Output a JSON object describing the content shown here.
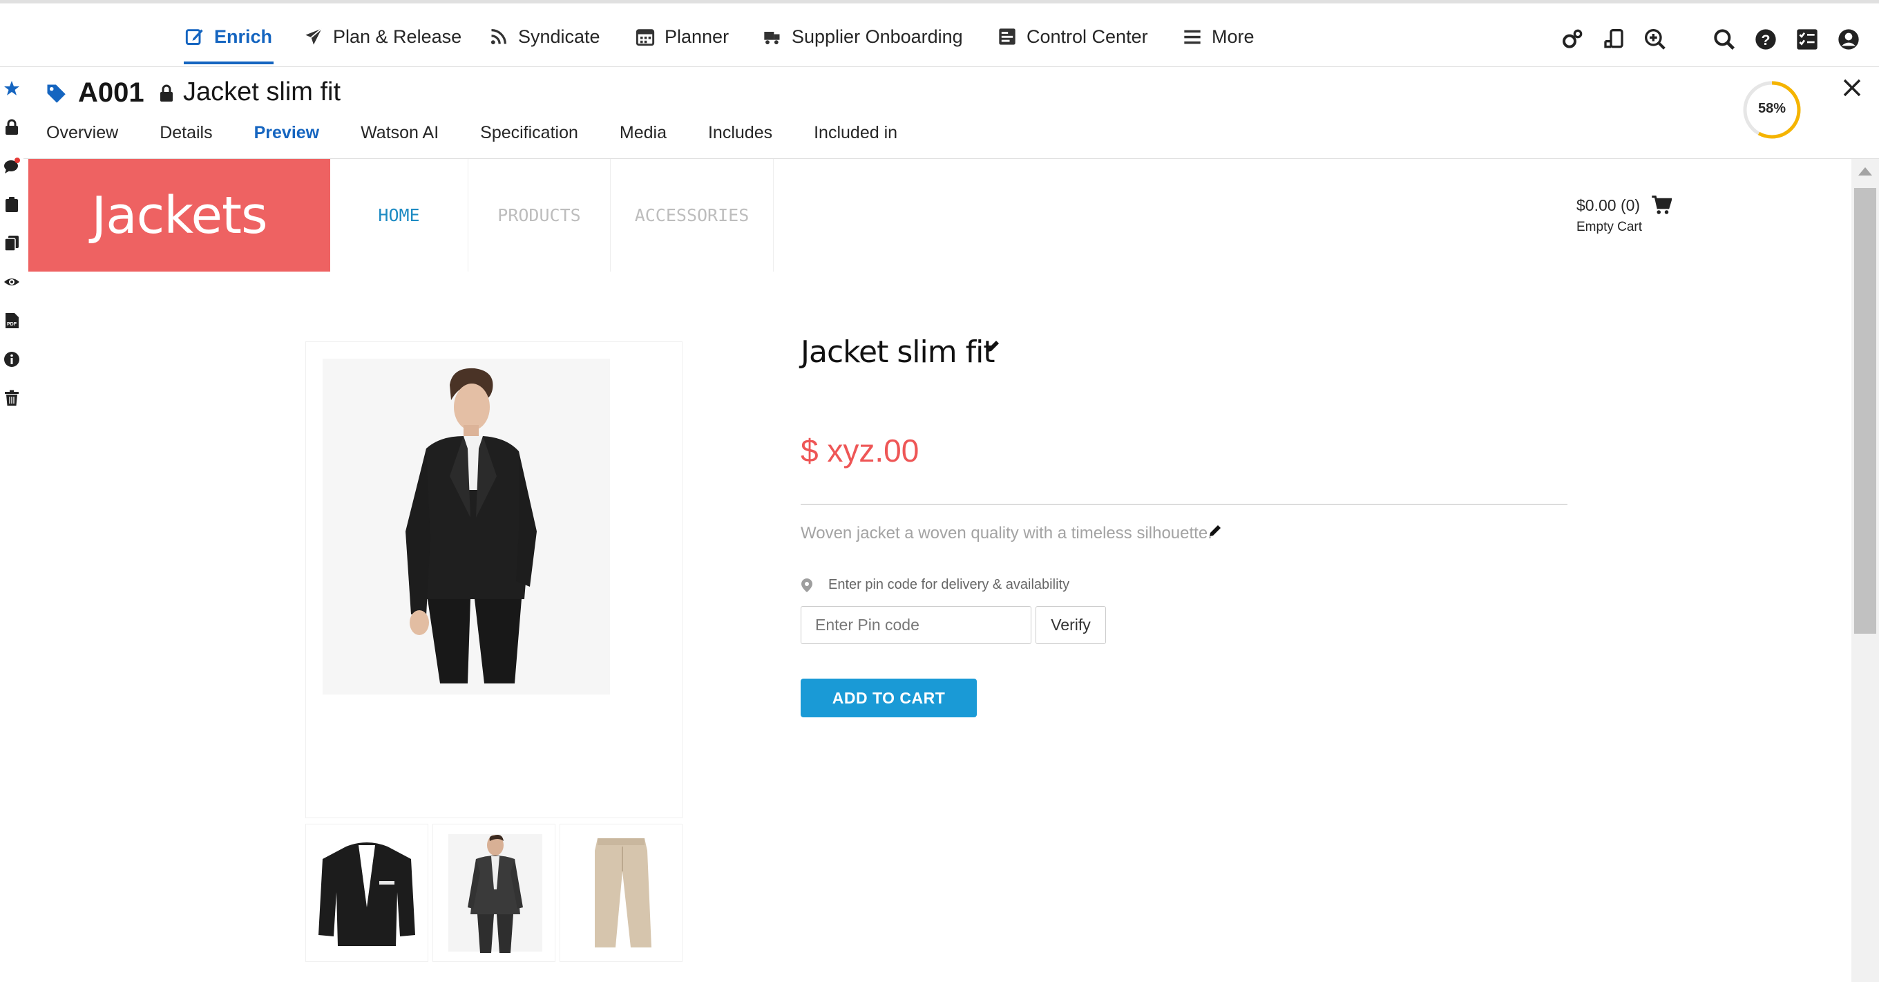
{
  "topnav": {
    "items": [
      {
        "label": "Enrich",
        "icon": "edit-icon",
        "active": true
      },
      {
        "label": "Plan & Release",
        "icon": "rocket-icon"
      },
      {
        "label": "Syndicate",
        "icon": "rss-icon"
      },
      {
        "label": "Planner",
        "icon": "calendar-icon"
      },
      {
        "label": "Supplier Onboarding",
        "icon": "truck-icon"
      },
      {
        "label": "Control Center",
        "icon": "dashboard-icon"
      },
      {
        "label": "More",
        "icon": "hamburger-icon"
      }
    ],
    "tools": [
      "settings-gear-icon",
      "device-sync-icon",
      "zoom-in-icon",
      "search-icon",
      "help-icon",
      "task-list-icon",
      "user-icon"
    ]
  },
  "rail": {
    "icons": [
      "star-icon",
      "lock-icon",
      "comments-icon",
      "clipboard-icon",
      "copy-icon",
      "eye-icon",
      "pdf-icon",
      "info-icon",
      "trash-icon"
    ]
  },
  "header": {
    "item_id": "A001",
    "item_name": "Jacket slim fit",
    "completeness": "58%",
    "completeness_value": 0.58,
    "tabs": [
      "Overview",
      "Details",
      "Preview",
      "Watson AI",
      "Specification",
      "Media",
      "Includes",
      "Included in"
    ],
    "active_tab": "Preview"
  },
  "preview": {
    "brand": "Jackets",
    "nav": [
      "HOME",
      "PRODUCTS",
      "ACCESSORIES"
    ],
    "cart_amount": "$0.00 (0)",
    "cart_status": "Empty Cart",
    "product_title": "Jacket slim fit",
    "price": "$ xyz.00",
    "description": "Woven jacket a woven quality with a timeless silhouette.",
    "pin_hint": "Enter pin code for delivery & availability",
    "pin_placeholder": "Enter Pin code",
    "verify_label": "Verify",
    "add_to_cart_label": "ADD TO CART",
    "colors": {
      "brand": "#ee6262",
      "price": "#ee5656",
      "button": "#1a9ad6",
      "accent": "#1565c0"
    }
  }
}
